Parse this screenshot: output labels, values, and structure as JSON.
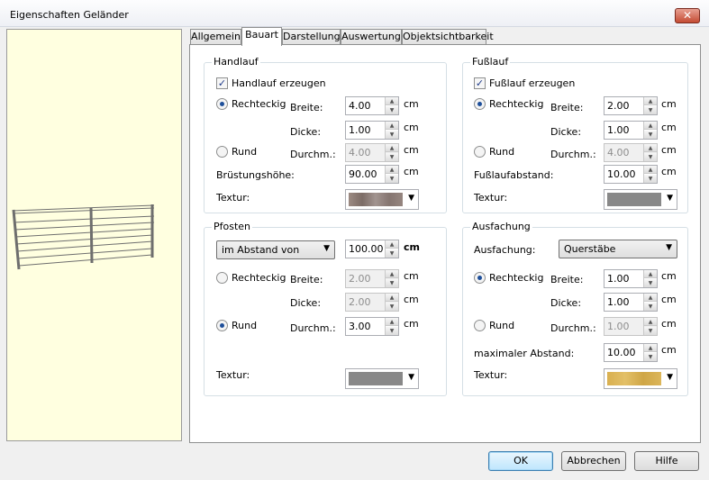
{
  "window": {
    "title": "Eigenschaften Geländer",
    "close": "✕"
  },
  "tabs": [
    "Allgemein",
    "Bauart",
    "Darstellung",
    "Auswertung",
    "Objektsichtbarkeit"
  ],
  "handlauf": {
    "title": "Handlauf",
    "checkbox_label": "Handlauf erzeugen",
    "rect_label": "Rechteckig",
    "breite_label": "Breite:",
    "breite": "4.00",
    "dicke_label": "Dicke:",
    "dicke": "1.00",
    "rund_label": "Rund",
    "durchm_label": "Durchm.:",
    "durchm": "4.00",
    "bh_label": "Brüstungshöhe:",
    "bh": "90.00",
    "textur_label": "Textur:",
    "unit": "cm",
    "tex_color": "#8f7f78"
  },
  "fusslauf": {
    "title": "Fußlauf",
    "checkbox_label": "Fußlauf erzeugen",
    "rect_label": "Rechteckig",
    "breite_label": "Breite:",
    "breite": "2.00",
    "dicke_label": "Dicke:",
    "dicke": "1.00",
    "rund_label": "Rund",
    "durchm_label": "Durchm.:",
    "durchm": "4.00",
    "abstand_label": "Fußlaufabstand:",
    "abstand": "10.00",
    "textur_label": "Textur:",
    "unit": "cm",
    "tex_color": "#888888"
  },
  "pfosten": {
    "title": "Pfosten",
    "mode": "im Abstand von",
    "abstand": "100.00",
    "rect_label": "Rechteckig",
    "breite_label": "Breite:",
    "breite": "2.00",
    "dicke_label": "Dicke:",
    "dicke": "2.00",
    "rund_label": "Rund",
    "durchm_label": "Durchm.:",
    "durchm": "3.00",
    "textur_label": "Textur:",
    "unit": "cm",
    "tex_color": "#888888"
  },
  "ausfachung": {
    "title": "Ausfachung",
    "ausfachung_label": "Ausfachung:",
    "mode": "Querstäbe",
    "rect_label": "Rechteckig",
    "breite_label": "Breite:",
    "breite": "1.00",
    "dicke_label": "Dicke:",
    "dicke": "1.00",
    "rund_label": "Rund",
    "durchm_label": "Durchm.:",
    "durchm": "1.00",
    "max_label": "maximaler Abstand:",
    "max": "10.00",
    "textur_label": "Textur:",
    "unit": "cm",
    "tex_color": "#d9b050"
  },
  "buttons": {
    "ok": "OK",
    "cancel": "Abbrechen",
    "help": "Hilfe"
  },
  "icons": {
    "check": "✓",
    "up": "▲",
    "down": "▼",
    "dropdown": "▼"
  }
}
